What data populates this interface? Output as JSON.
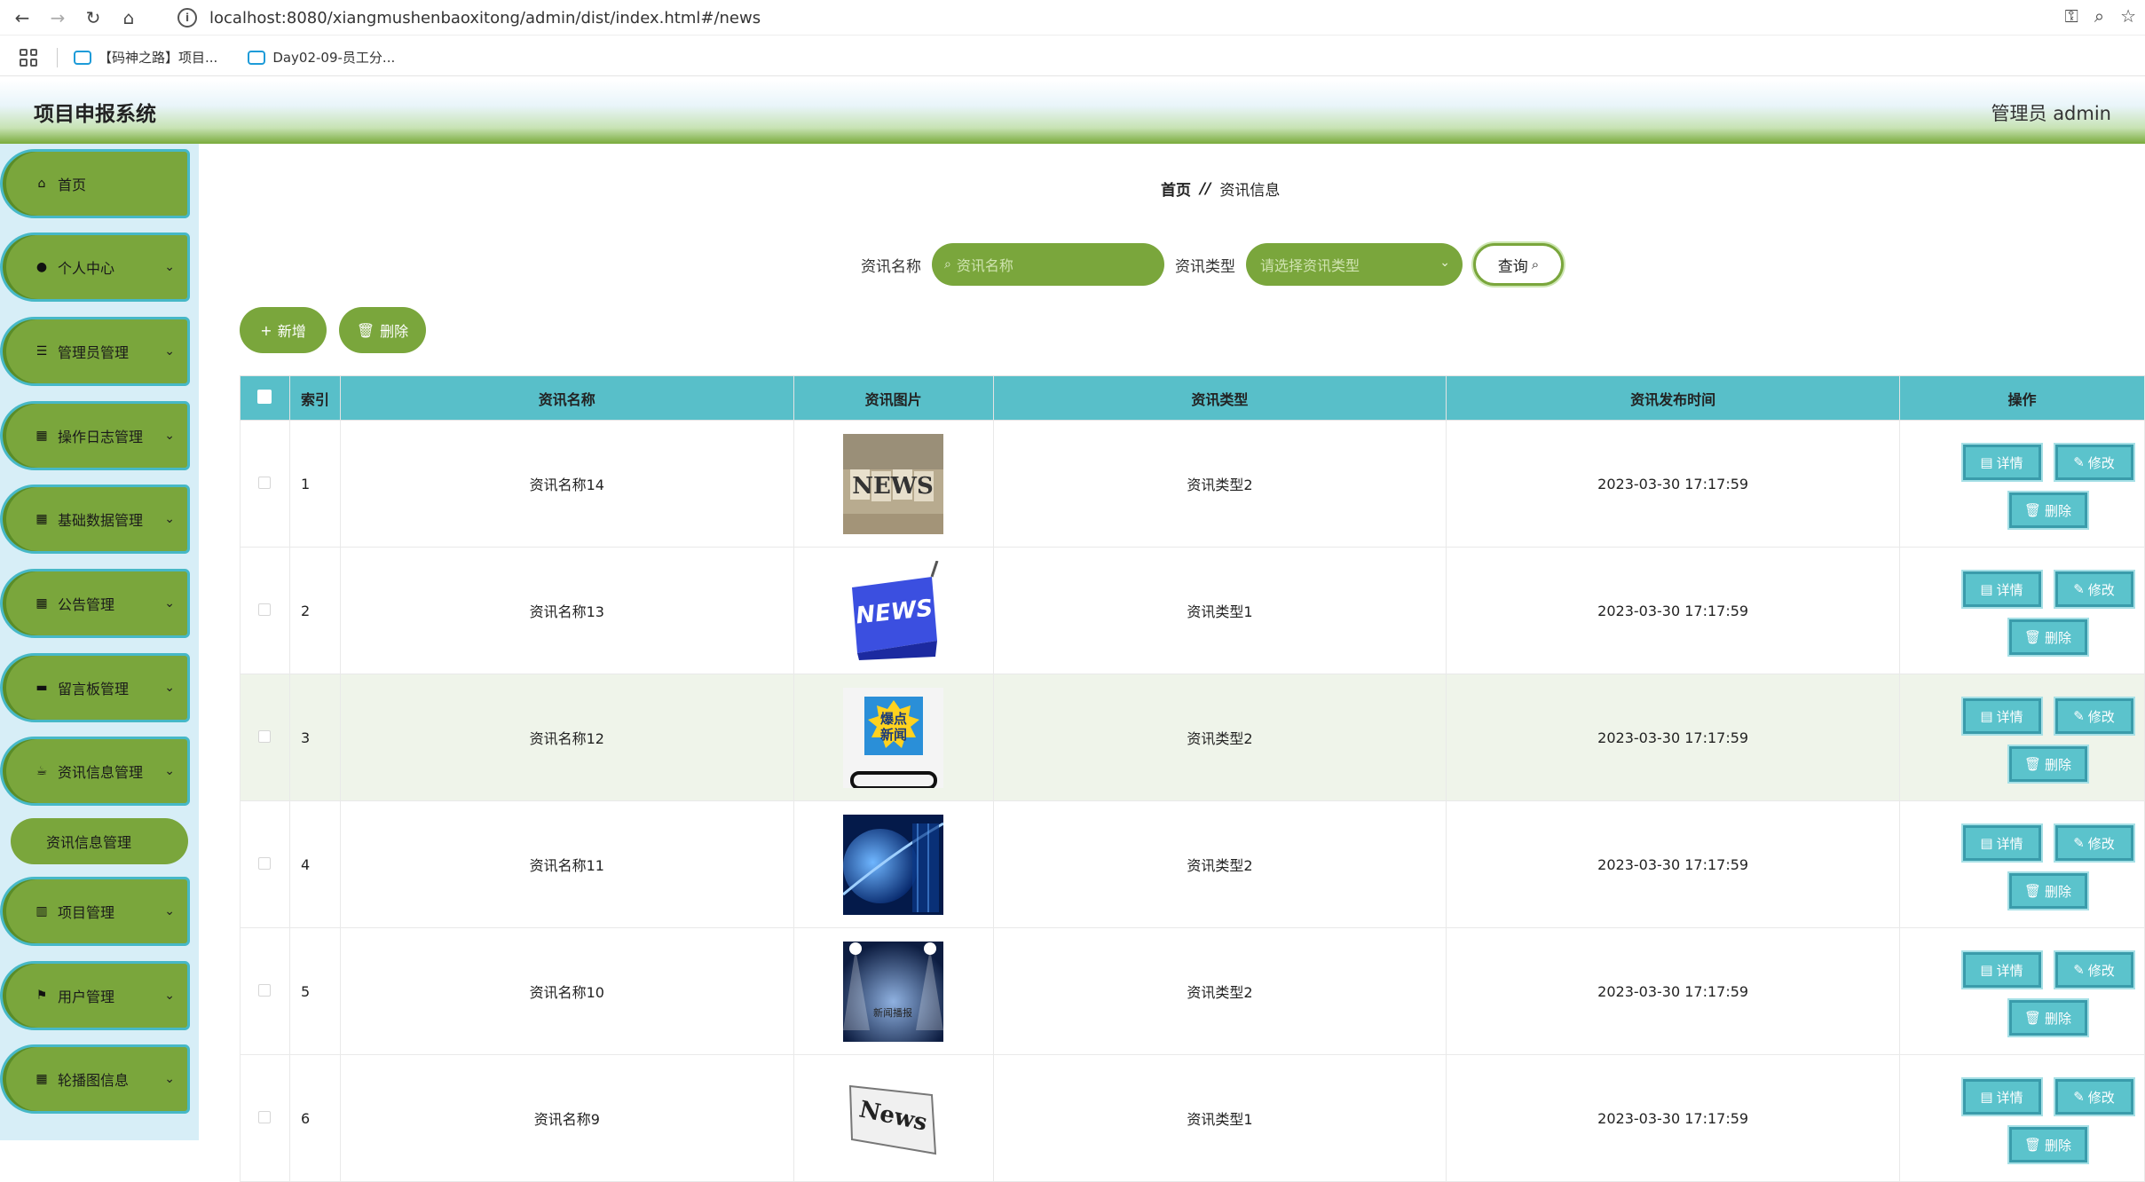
{
  "browser": {
    "url": "localhost:8080/xiangmushenbaoxitong/admin/dist/index.html#/news",
    "bookmarks": [
      "【码神之路】项目...",
      "Day02-09-员工分..."
    ]
  },
  "header": {
    "title": "项目申报系统",
    "user_label": "管理员 admin"
  },
  "sidebar": {
    "items": [
      {
        "label": "首页",
        "icon": "home-icon"
      },
      {
        "label": "个人中心",
        "icon": "user-icon"
      },
      {
        "label": "管理员管理",
        "icon": "list-icon"
      },
      {
        "label": "操作日志管理",
        "icon": "grid-icon"
      },
      {
        "label": "基础数据管理",
        "icon": "grid-icon"
      },
      {
        "label": "公告管理",
        "icon": "grid-icon"
      },
      {
        "label": "留言板管理",
        "icon": "ticket-icon"
      },
      {
        "label": "资讯信息管理",
        "icon": "coffee-icon"
      },
      {
        "label": "项目管理",
        "icon": "books-icon"
      },
      {
        "label": "用户管理",
        "icon": "flag-icon"
      },
      {
        "label": "轮播图信息",
        "icon": "grid-icon"
      }
    ],
    "sub_item": "资讯信息管理"
  },
  "breadcrumb": {
    "home": "首页",
    "sep": "//",
    "current": "资讯信息"
  },
  "search": {
    "name_label": "资讯名称",
    "name_placeholder": "资讯名称",
    "type_label": "资讯类型",
    "type_placeholder": "请选择资讯类型",
    "query_label": "查询"
  },
  "actions": {
    "add_label": "新增",
    "delete_label": "删除"
  },
  "table": {
    "headers": [
      "索引",
      "资讯名称",
      "资讯图片",
      "资讯类型",
      "资讯发布时间",
      "操作"
    ],
    "rows": [
      {
        "index": "1",
        "name": "资讯名称14",
        "image": "news-letters-blocks",
        "type": "资讯类型2",
        "time": "2023-03-30 17:17:59"
      },
      {
        "index": "2",
        "name": "资讯名称13",
        "image": "news-blue-key",
        "type": "资讯类型1",
        "time": "2023-03-30 17:17:59"
      },
      {
        "index": "3",
        "name": "资讯名称12",
        "image": "breaking-news-phone",
        "type": "资讯类型2",
        "time": "2023-03-30 17:17:59"
      },
      {
        "index": "4",
        "name": "资讯名称11",
        "image": "globe-blue",
        "type": "资讯类型2",
        "time": "2023-03-30 17:17:59"
      },
      {
        "index": "5",
        "name": "资讯名称10",
        "image": "stage-spotlights",
        "type": "资讯类型2",
        "time": "2023-03-30 17:17:59"
      },
      {
        "index": "6",
        "name": "资讯名称9",
        "image": "news-newspaper",
        "type": "资讯类型1",
        "time": "2023-03-30 17:17:59"
      }
    ],
    "row_ops": {
      "detail": "详情",
      "edit": "修改",
      "delete": "删除"
    },
    "image_texts": {
      "news1": "NEWS",
      "news2": "NEWS",
      "breaking": "爆点新闻",
      "stage": "新闻播报",
      "paper": "News"
    }
  },
  "colors": {
    "accent_green": "#7aa63c",
    "table_header": "#58bfc9",
    "op_button": "#5bc3cc"
  }
}
